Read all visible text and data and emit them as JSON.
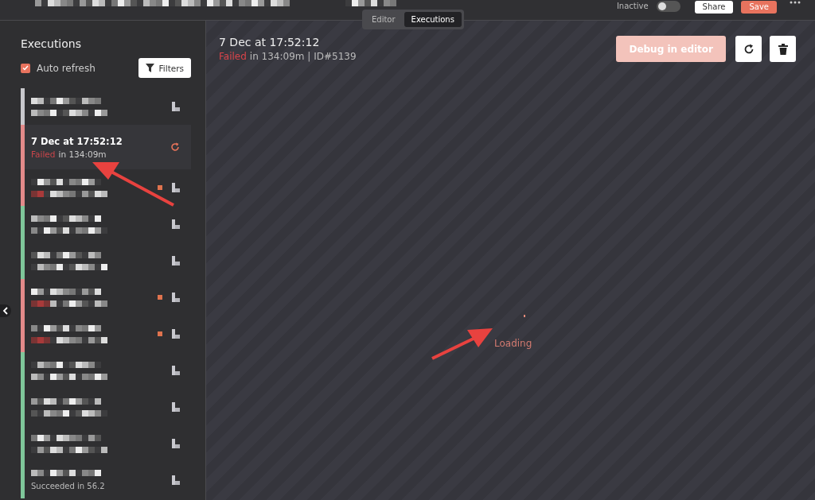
{
  "header": {
    "active_toggle": {
      "label": "Inactive",
      "on": false
    },
    "buttons": [
      {
        "label": "Share",
        "kind": "secondary"
      },
      {
        "label": "Save",
        "kind": "primary"
      }
    ]
  },
  "tabs": [
    {
      "label": "Editor",
      "selected": false
    },
    {
      "label": "Executions",
      "selected": true
    }
  ],
  "sidebar": {
    "title": "Executions",
    "auto_refresh": {
      "label": "Auto refresh",
      "checked": true
    },
    "filters_button": "Filters",
    "executions": [
      {
        "color": "#c8c8cc",
        "selected": false,
        "flagged": false
      },
      {
        "color": "#e38a8a",
        "selected": true,
        "flagged": false,
        "title": "7 Dec at 17:52:12",
        "status_label": "Failed",
        "duration": "in 134:09m"
      },
      {
        "color": "#e38a8a",
        "selected": false,
        "flagged": true
      },
      {
        "color": "#7fc69a",
        "selected": false,
        "flagged": false
      },
      {
        "color": "#7fc69a",
        "selected": false,
        "flagged": false
      },
      {
        "color": "#e38a8a",
        "selected": false,
        "flagged": true
      },
      {
        "color": "#e38a8a",
        "selected": false,
        "flagged": true
      },
      {
        "color": "#7fc69a",
        "selected": false,
        "flagged": false
      },
      {
        "color": "#7fc69a",
        "selected": false,
        "flagged": false
      },
      {
        "color": "#7fc69a",
        "selected": false,
        "flagged": false
      },
      {
        "color": "#7fc69a",
        "selected": false,
        "flagged": false,
        "subtitle": "Succeeded in 56.2"
      }
    ]
  },
  "detail": {
    "title": "7 Dec at 17:52:12",
    "status_label": "Failed",
    "summary": "in 134:09m | ID#5139",
    "debug_button": {
      "label": "Debug in editor",
      "disabled": true
    },
    "loading_label": "Loading"
  }
}
